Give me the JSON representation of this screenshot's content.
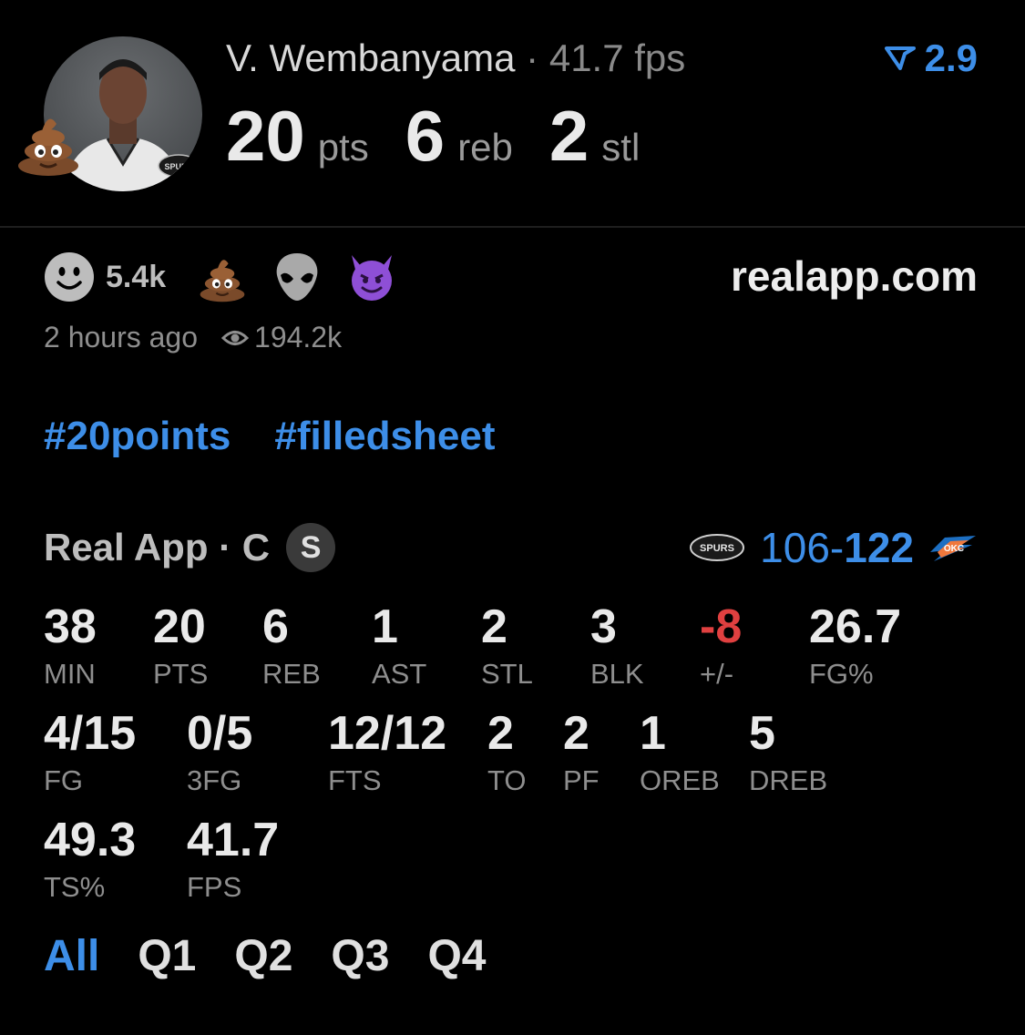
{
  "header": {
    "player_name": "V. Wembanyama",
    "fps_text": " · 41.7 fps",
    "arrow_value": "2.9",
    "headline": [
      {
        "value": "20",
        "unit": "pts"
      },
      {
        "value": "6",
        "unit": "reb"
      },
      {
        "value": "2",
        "unit": "stl"
      }
    ]
  },
  "reactions": {
    "count": "5.4k",
    "icons": [
      "smiley-face-icon",
      "poop-emoji-icon",
      "alien-emoji-icon",
      "devil-emoji-icon"
    ],
    "site": "realapp.com",
    "time_ago": "2 hours ago",
    "views": "194.2k"
  },
  "tags": [
    "#20points",
    "#filledsheet"
  ],
  "game": {
    "label": "Real App · C",
    "badge": "S",
    "score_left": "106-",
    "score_right": "122"
  },
  "stats_row1": [
    {
      "value": "38",
      "label": "MIN"
    },
    {
      "value": "20",
      "label": "PTS"
    },
    {
      "value": "6",
      "label": "REB"
    },
    {
      "value": "1",
      "label": "AST"
    },
    {
      "value": "2",
      "label": "STL"
    },
    {
      "value": "3",
      "label": "BLK"
    },
    {
      "value": "-8",
      "label": "+/-"
    },
    {
      "value": "26.7",
      "label": "FG%"
    }
  ],
  "stats_row2": [
    {
      "value": "4/15",
      "label": "FG"
    },
    {
      "value": "0/5",
      "label": "3FG"
    },
    {
      "value": "12/12",
      "label": "FTS"
    },
    {
      "value": "2",
      "label": "TO"
    },
    {
      "value": "2",
      "label": "PF"
    },
    {
      "value": "1",
      "label": "OREB"
    },
    {
      "value": "5",
      "label": "DREB"
    }
  ],
  "stats_row3": [
    {
      "value": "49.3",
      "label": "TS%"
    },
    {
      "value": "41.7",
      "label": "FPS"
    }
  ],
  "tabs": [
    "All",
    "Q1",
    "Q2",
    "Q3",
    "Q4"
  ],
  "colors": {
    "accent": "#3d8ee8",
    "negative": "#e04040",
    "background": "#000000"
  }
}
